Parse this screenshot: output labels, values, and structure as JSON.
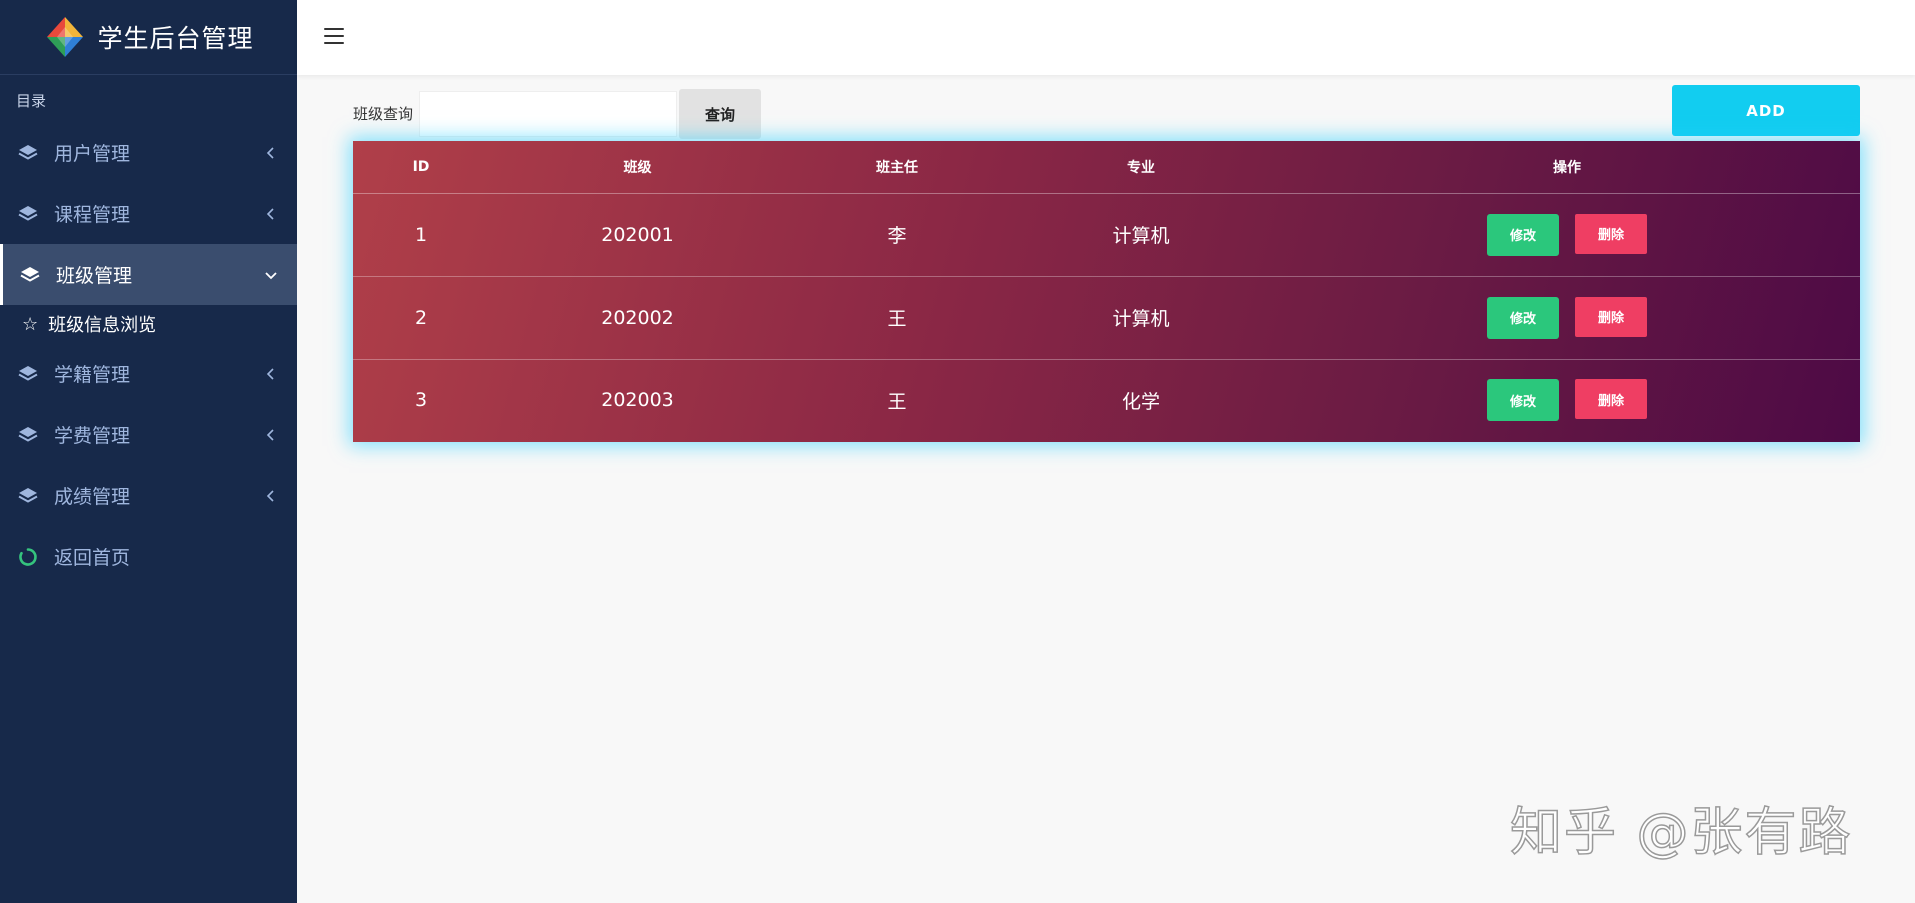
{
  "sidebar": {
    "brand_title": "学生后台管理",
    "menu_heading": "目录",
    "items": [
      {
        "label": "用户管理",
        "icon": "layers-icon",
        "active": false
      },
      {
        "label": "课程管理",
        "icon": "layers-icon",
        "active": false
      },
      {
        "label": "班级管理",
        "icon": "layers-icon",
        "active": true
      },
      {
        "label": "学籍管理",
        "icon": "layers-icon",
        "active": false
      },
      {
        "label": "学费管理",
        "icon": "layers-icon",
        "active": false
      },
      {
        "label": "成绩管理",
        "icon": "layers-icon",
        "active": false
      }
    ],
    "submenu": {
      "label": "班级信息浏览",
      "icon": "star-icon"
    },
    "home": {
      "label": "返回首页",
      "icon": "refresh-circle-icon"
    }
  },
  "search": {
    "label": "班级查询",
    "value": "",
    "button_label": "查询"
  },
  "add_button_label": "ADD",
  "table": {
    "headers": [
      "ID",
      "班级",
      "班主任",
      "专业",
      "操作"
    ],
    "rows": [
      {
        "id": "1",
        "class": "202001",
        "teacher": "李",
        "major": "计算机"
      },
      {
        "id": "2",
        "class": "202002",
        "teacher": "王",
        "major": "计算机"
      },
      {
        "id": "3",
        "class": "202003",
        "teacher": "王",
        "major": "化学"
      }
    ],
    "edit_label": "修改",
    "delete_label": "删除"
  },
  "watermark": "知乎 @张有路",
  "colors": {
    "sidebar_bg": "#17294a",
    "add_button": "#12cdf0",
    "edit_button": "#2bc77c",
    "delete_button": "#ef3e63"
  }
}
